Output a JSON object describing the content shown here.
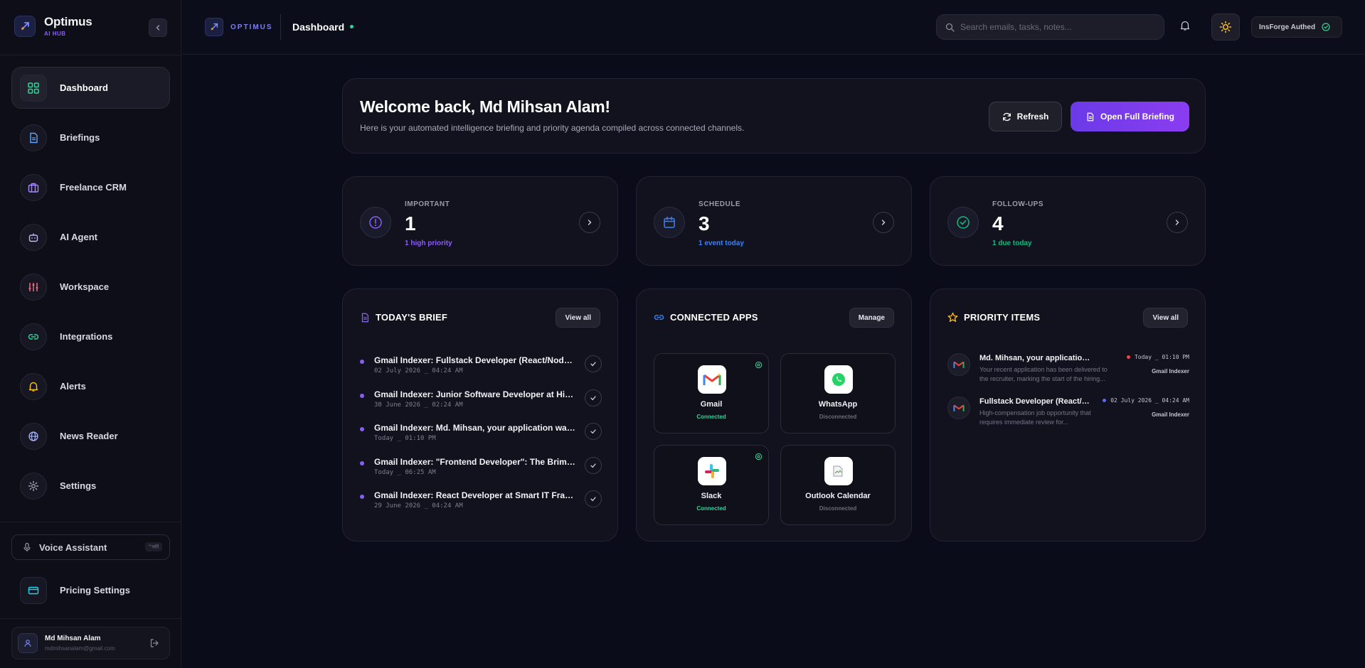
{
  "brand": {
    "name": "Optimus",
    "subtitle": "AI HUB"
  },
  "sidebar": {
    "items": [
      {
        "label": "Dashboard",
        "icon": "grid-icon",
        "active": true
      },
      {
        "label": "Briefings",
        "icon": "document-icon"
      },
      {
        "label": "Freelance CRM",
        "icon": "briefcase-icon"
      },
      {
        "label": "AI Agent",
        "icon": "bot-icon"
      },
      {
        "label": "Workspace",
        "icon": "sliders-icon"
      },
      {
        "label": "Integrations",
        "icon": "link-icon"
      },
      {
        "label": "Alerts",
        "icon": "bell-icon"
      },
      {
        "label": "News Reader",
        "icon": "globe-icon"
      },
      {
        "label": "Settings",
        "icon": "gear-icon"
      }
    ],
    "voice_label": "Voice Assistant",
    "voice_shortcut": "^⌘M",
    "pricing_label": "Pricing Settings",
    "user": {
      "name": "Md Mihsan Alam",
      "email": "mdmihsanalam@gmail.com"
    }
  },
  "topbar": {
    "brand": "OPTIMUS",
    "title": "Dashboard",
    "search_placeholder": "Search emails, tasks, notes...",
    "auth_label": "InsForge Authed"
  },
  "welcome": {
    "title": "Welcome back, Md Mihsan Alam!",
    "subtitle": "Here is your automated intelligence briefing and priority agenda compiled across connected channels.",
    "refresh_label": "Refresh",
    "briefing_label": "Open Full Briefing"
  },
  "stats": [
    {
      "label": "IMPORTANT",
      "value": "1",
      "sub": "1 high priority",
      "color": "#8b5cf6"
    },
    {
      "label": "SCHEDULE",
      "value": "3",
      "sub": "1 event today",
      "color": "#3b82f6"
    },
    {
      "label": "FOLLOW-UPS",
      "value": "4",
      "sub": "1 due today",
      "color": "#10b981"
    }
  ],
  "brief": {
    "title": "TODAY'S BRIEF",
    "button": "View all",
    "items": [
      {
        "title": "Gmail Indexer: Fullstack Developer (React/Node.js)",
        "date": "02 July 2026 _ 04:24 AM"
      },
      {
        "title": "Gmail Indexer: Junior Software Developer at Hireline",
        "date": "30 June 2026 _ 02:24 AM"
      },
      {
        "title": "Gmail Indexer: Md. Mihsan, your application was sent",
        "date": "Today _ 01:10 PM"
      },
      {
        "title": "Gmail Indexer: \"Frontend Developer\": The Brimington",
        "date": "Today _ 06:25 AM"
      },
      {
        "title": "Gmail Indexer: React Developer at Smart IT Framework",
        "date": "29 June 2026 _ 04:24 AM"
      }
    ]
  },
  "apps": {
    "title": "CONNECTED APPS",
    "button": "Manage",
    "items": [
      {
        "name": "Gmail",
        "status": "Connected",
        "icon": "gmail-icon"
      },
      {
        "name": "WhatsApp",
        "status": "Disconnected",
        "icon": "whatsapp-icon"
      },
      {
        "name": "Slack",
        "status": "Connected",
        "icon": "slack-icon"
      },
      {
        "name": "Outlook Calendar",
        "status": "Disconnected",
        "icon": "broken-image-icon"
      }
    ]
  },
  "priority": {
    "title": "PRIORITY ITEMS",
    "button": "View all",
    "items": [
      {
        "title": "Md. Mihsan, your application was sent to",
        "desc": "Your recent application has been delivered to the recruiter, marking the start of the hiring...",
        "time": "Today _ 01:10 PM",
        "source": "Gmail Indexer",
        "dot": "#ef4444"
      },
      {
        "title": "Fullstack Developer (React/Node.js)",
        "desc": "High-compensation job opportunity that requires immediate review for...",
        "time": "02 July 2026 _ 04:24 AM",
        "source": "Gmail Indexer",
        "dot": "#6366f1"
      }
    ]
  }
}
